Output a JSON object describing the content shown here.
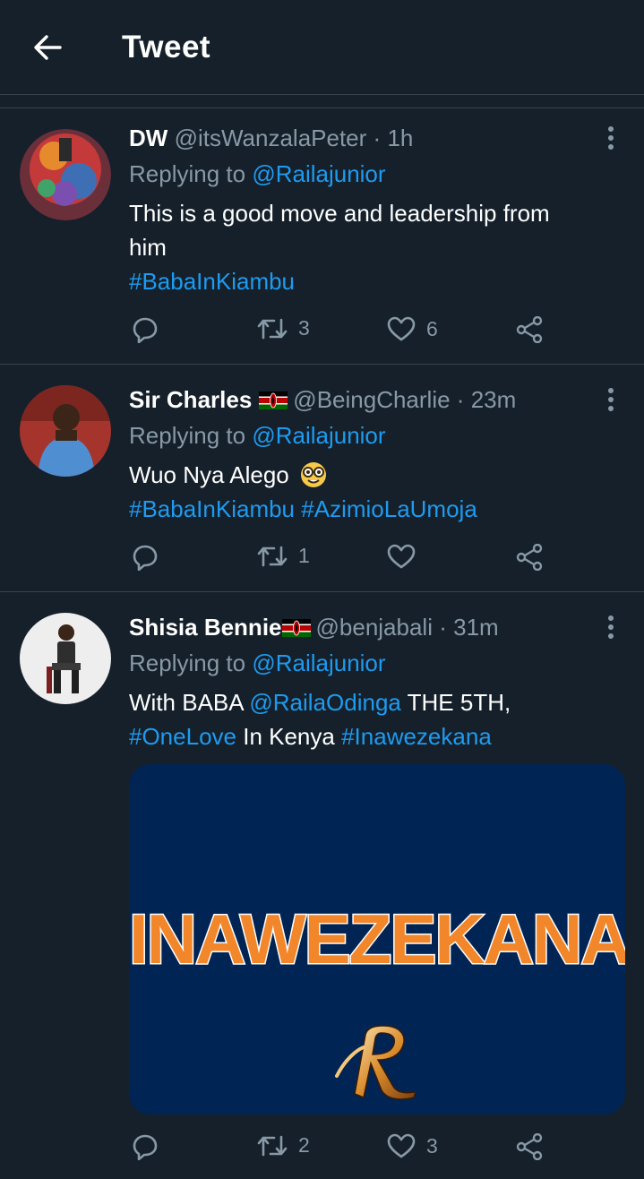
{
  "header": {
    "title": "Tweet",
    "back_icon": "arrow-left-icon"
  },
  "colors": {
    "background": "#15202b",
    "link": "#1d9bf0",
    "muted": "#8899a6",
    "divider": "#38444d",
    "media_bg": "#002454",
    "media_text": "#f2862a"
  },
  "tweets": [
    {
      "display_name": "DW",
      "handle": "@itsWanzalaPeter",
      "separator": "·",
      "time": "1h",
      "replying_to_label": "Replying to",
      "replying_to": "@Railajunior",
      "text_line_1": "This is a good move and leadership from",
      "text_line_2": "him",
      "hashtag_1": "#BabaInKiambu",
      "retweet_count": "3",
      "like_count": "6"
    },
    {
      "display_name": "Sir Charles",
      "flag": "kenya-flag-icon",
      "handle": "@BeingCharlie",
      "separator": "·",
      "time": "23m",
      "replying_to_label": "Replying to",
      "replying_to": "@Railajunior",
      "text_line_1": "Wuo Nya Alego",
      "emoji": "nerd-face-icon",
      "hashtag_1": "#BabaInKiambu",
      "hashtag_2": "#AzimioLaUmoja",
      "retweet_count": "1",
      "like_count": ""
    },
    {
      "display_name": "Shisia Bennie",
      "flag": "kenya-flag-icon",
      "handle": "@benjabali",
      "separator": "·",
      "time": "31m",
      "replying_to_label": "Replying to",
      "replying_to": "@Railajunior",
      "text_pre": "With BABA",
      "mention": "@RailaOdinga",
      "text_post": "THE 5TH,",
      "hashtag_1": "#OneLove",
      "text_mid": "In Kenya",
      "hashtag_2": "#Inawezekana",
      "media_text": "INAWEZEKANA",
      "retweet_count": "2",
      "like_count": "3"
    }
  ]
}
